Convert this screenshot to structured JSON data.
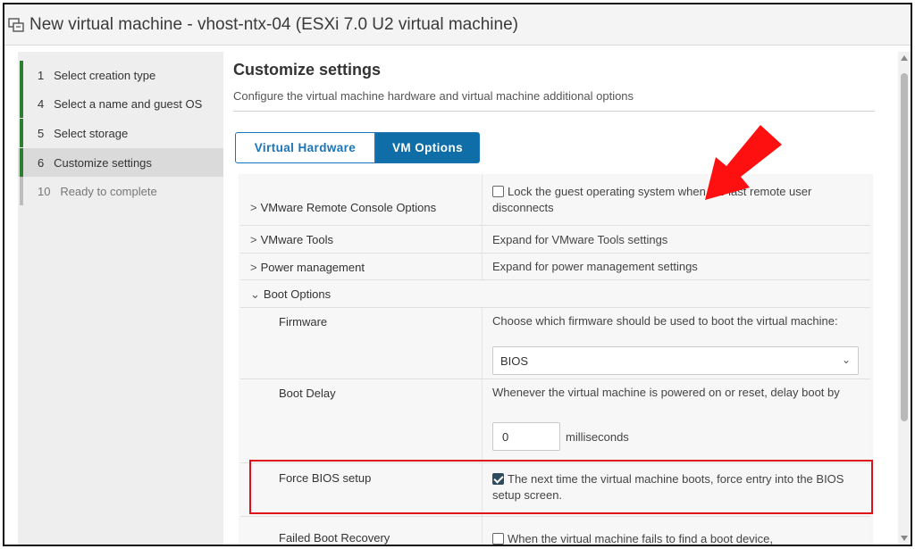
{
  "window": {
    "title": "New virtual machine - vhost-ntx-04 (ESXi 7.0 U2 virtual machine)",
    "icon": "vm-window-icon"
  },
  "steps": [
    {
      "number": "1",
      "label": "Select creation type",
      "status": "done"
    },
    {
      "number": "4",
      "label": "Select a name and guest OS",
      "status": "done"
    },
    {
      "number": "5",
      "label": "Select storage",
      "status": "done"
    },
    {
      "number": "6",
      "label": "Customize settings",
      "status": "current"
    },
    {
      "number": "10",
      "label": "Ready to complete",
      "status": "pending"
    }
  ],
  "page": {
    "title": "Customize settings",
    "subtitle": "Configure the virtual machine hardware and virtual machine additional options"
  },
  "tabs": [
    {
      "label": "Virtual Hardware",
      "active": false
    },
    {
      "label": "VM Options",
      "active": true
    }
  ],
  "rows": {
    "remote_console": {
      "name": "VMware Remote Console Options",
      "checkbox_checked": false,
      "value": "Lock the guest operating system when the last remote user disconnects"
    },
    "tools": {
      "name": "VMware Tools",
      "value": "Expand for VMware Tools settings"
    },
    "power": {
      "name": "Power management",
      "value": "Expand for power management settings"
    },
    "boot_options": {
      "name": "Boot Options",
      "expanded": true
    },
    "firmware": {
      "name": "Firmware",
      "value": "Choose which firmware should be used to boot the virtual machine:",
      "selected": "BIOS"
    },
    "boot_delay": {
      "name": "Boot Delay",
      "value": "Whenever the virtual machine is powered on or reset, delay boot by",
      "input_value": "0",
      "unit": "milliseconds"
    },
    "force_bios": {
      "name": "Force BIOS setup",
      "checkbox_checked": true,
      "value": "The next time the virtual machine boots, force entry into the BIOS setup screen."
    },
    "failed_boot": {
      "name": "Failed Boot Recovery",
      "checkbox_checked": false,
      "value": "When the virtual machine fails to find a boot device,"
    }
  },
  "colors": {
    "accent_blue": "#0f6ea8",
    "step_done": "#2e7d32",
    "highlight_red": "#e0101a",
    "arrow_red": "#ff1010"
  }
}
